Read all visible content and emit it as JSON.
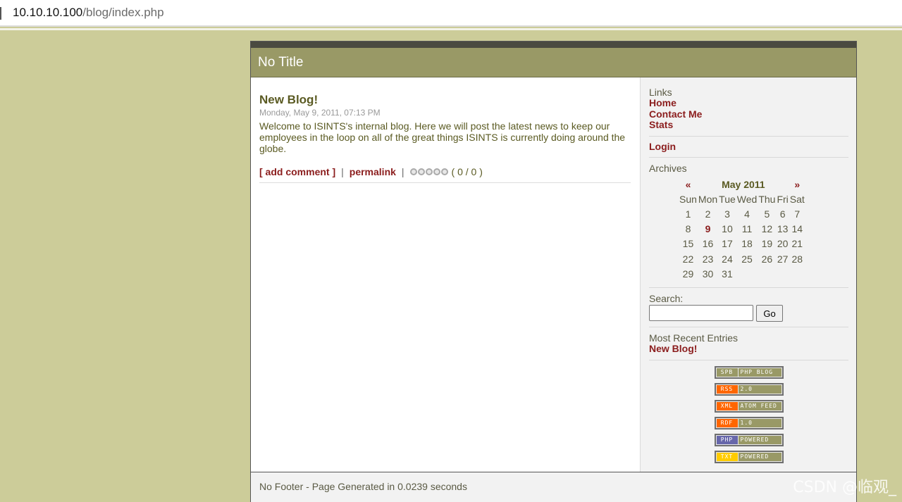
{
  "browser": {
    "url_host": "10.10.10.100",
    "url_path": "/blog/index.php"
  },
  "blog": {
    "title": "No Title",
    "footer": "No Footer - Page Generated in 0.0239 seconds"
  },
  "entry": {
    "title": "New Blog!",
    "date": "Monday, May 9, 2011, 07:13 PM",
    "body": "Welcome to ISINTS's internal blog. Here we will post the latest news to keep our employees in the loop on all of the great things ISINTS is currently doing around the globe.",
    "add_comment": "[ add comment ]",
    "separator": "|",
    "permalink": "permalink",
    "rating_text": "( 0 / 0 )",
    "rating_stars": 0
  },
  "sidebar": {
    "links_label": "Links",
    "links": [
      "Home",
      "Contact Me",
      "Stats"
    ],
    "login": "Login",
    "archives_label": "Archives",
    "calendar": {
      "prev": "«",
      "next": "»",
      "month": "May 2011",
      "days": [
        "Sun",
        "Mon",
        "Tue",
        "Wed",
        "Thu",
        "Fri",
        "Sat"
      ],
      "weeks": [
        [
          "1",
          "2",
          "3",
          "4",
          "5",
          "6",
          "7"
        ],
        [
          "8",
          "9",
          "10",
          "11",
          "12",
          "13",
          "14"
        ],
        [
          "15",
          "16",
          "17",
          "18",
          "19",
          "20",
          "21"
        ],
        [
          "22",
          "23",
          "24",
          "25",
          "26",
          "27",
          "28"
        ],
        [
          "29",
          "30",
          "31",
          "",
          "",
          "",
          ""
        ]
      ],
      "highlighted_day": "9"
    },
    "search_label": "Search:",
    "search_value": "",
    "go_label": "Go",
    "recent_label": "Most Recent Entries",
    "recent_entries": [
      "New Blog!"
    ]
  },
  "badges": [
    {
      "left": "SPB",
      "right": "PHP BLOG",
      "left_color": "#999966",
      "right_color": "#999966"
    },
    {
      "left": "RSS",
      "right": "2.0",
      "left_color": "#ff6600",
      "right_color": "#999966"
    },
    {
      "left": "XML",
      "right": "ATOM FEED",
      "left_color": "#ff6600",
      "right_color": "#999966"
    },
    {
      "left": "RDF",
      "right": "1.0",
      "left_color": "#ff6600",
      "right_color": "#999966"
    },
    {
      "left": "PHP",
      "right": "POWERED",
      "left_color": "#6666aa",
      "right_color": "#999966"
    },
    {
      "left": "TXT",
      "right": "POWERED",
      "left_color": "#ffcc00",
      "right_color": "#999966"
    }
  ],
  "watermark": "CSDN @临观_",
  "colors": {
    "page_bg": "#cccc99",
    "header_bg": "#999966",
    "link": "#8b1d1d",
    "text": "#5a5a22"
  }
}
